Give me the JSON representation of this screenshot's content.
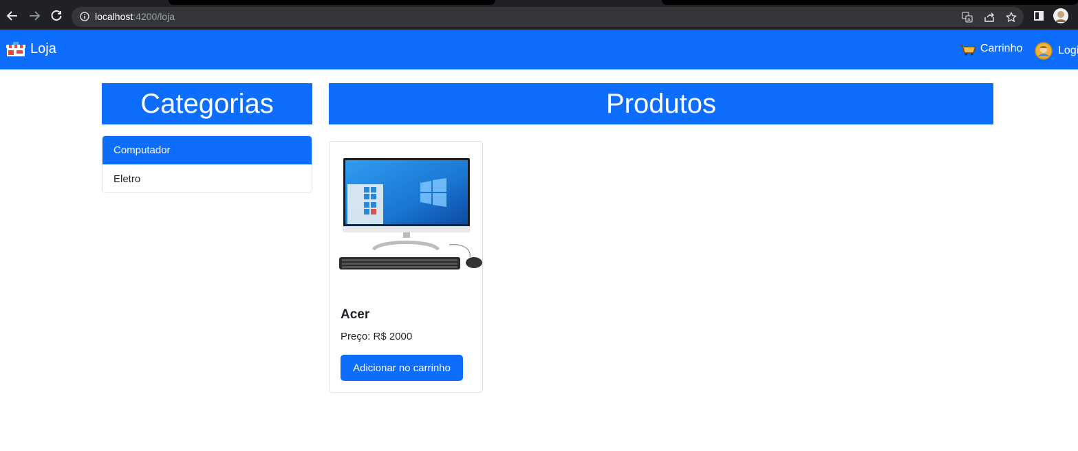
{
  "browser": {
    "url_host": "localhost",
    "url_rest": ":4200/loja"
  },
  "navbar": {
    "brand": "Loja",
    "cart_label": "Carrinho",
    "login_label": "Login"
  },
  "sidebar": {
    "title": "Categorias",
    "categories": [
      {
        "label": "Computador",
        "active": true
      },
      {
        "label": "Eletro",
        "active": false
      }
    ]
  },
  "main": {
    "title": "Produtos",
    "products": [
      {
        "name": "Acer",
        "price": "Preço: R$ 2000",
        "button": "Adicionar no carrinho"
      }
    ]
  },
  "colors": {
    "primary": "#0d6efd",
    "chrome_bg": "#202124"
  }
}
